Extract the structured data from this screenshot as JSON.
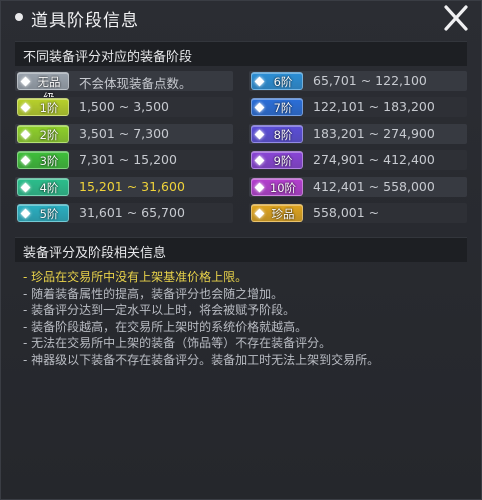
{
  "window": {
    "title": "道具阶段信息",
    "close_glyph": "X"
  },
  "section1": {
    "title": "不同装备评分对应的装备阶段"
  },
  "grades_left": [
    {
      "label": "无品级",
      "range": "不会体现装备点数。",
      "color": "#9aa3ad",
      "highlight": false
    },
    {
      "label": "1阶",
      "range": "1,500 ~ 3,500",
      "color": "#b9d22b",
      "highlight": false
    },
    {
      "label": "2阶",
      "range": "3,501 ~ 7,300",
      "color": "#8fd12a",
      "highlight": false
    },
    {
      "label": "3阶",
      "range": "7,301 ~ 15,200",
      "color": "#3fbf3a",
      "highlight": false
    },
    {
      "label": "4阶",
      "range": "15,201 ~ 31,600",
      "color": "#2bbf8c",
      "highlight": true
    },
    {
      "label": "5阶",
      "range": "31,601 ~ 65,700",
      "color": "#2ab0c2",
      "highlight": false
    }
  ],
  "grades_right": [
    {
      "label": "6阶",
      "range": "65,701 ~ 122,100",
      "color": "#2b8fd6",
      "highlight": false
    },
    {
      "label": "7阶",
      "range": "122,101 ~ 183,200",
      "color": "#2b6fd9",
      "highlight": false
    },
    {
      "label": "8阶",
      "range": "183,201 ~ 274,900",
      "color": "#5b4ed8",
      "highlight": false
    },
    {
      "label": "9阶",
      "range": "274,901 ~ 412,400",
      "color": "#8a45d6",
      "highlight": false
    },
    {
      "label": "10阶",
      "range": "412,401 ~ 558,000",
      "color": "#b43fcf",
      "highlight": false
    },
    {
      "label": "珍品",
      "range": "558,001 ~",
      "color": "#e0a51f",
      "highlight": false
    }
  ],
  "section2": {
    "title": "装备评分及阶段相关信息"
  },
  "info": [
    {
      "text": "- 珍品在交易所中没有上架基准价格上限。",
      "highlight": true
    },
    {
      "text": "- 随着装备属性的提高，装备评分也会随之增加。",
      "highlight": false
    },
    {
      "text": "- 装备评分达到一定水平以上时，将会被赋予阶段。",
      "highlight": false
    },
    {
      "text": "- 装备阶段越高，在交易所上架时的系统价格就越高。",
      "highlight": false
    },
    {
      "text": "- 无法在交易所中上架的装备（饰品等）不存在装备评分。",
      "highlight": false
    },
    {
      "text": "- 神器级以下装备不存在装备评分。装备加工时无法上架到交易所。",
      "highlight": false
    }
  ]
}
